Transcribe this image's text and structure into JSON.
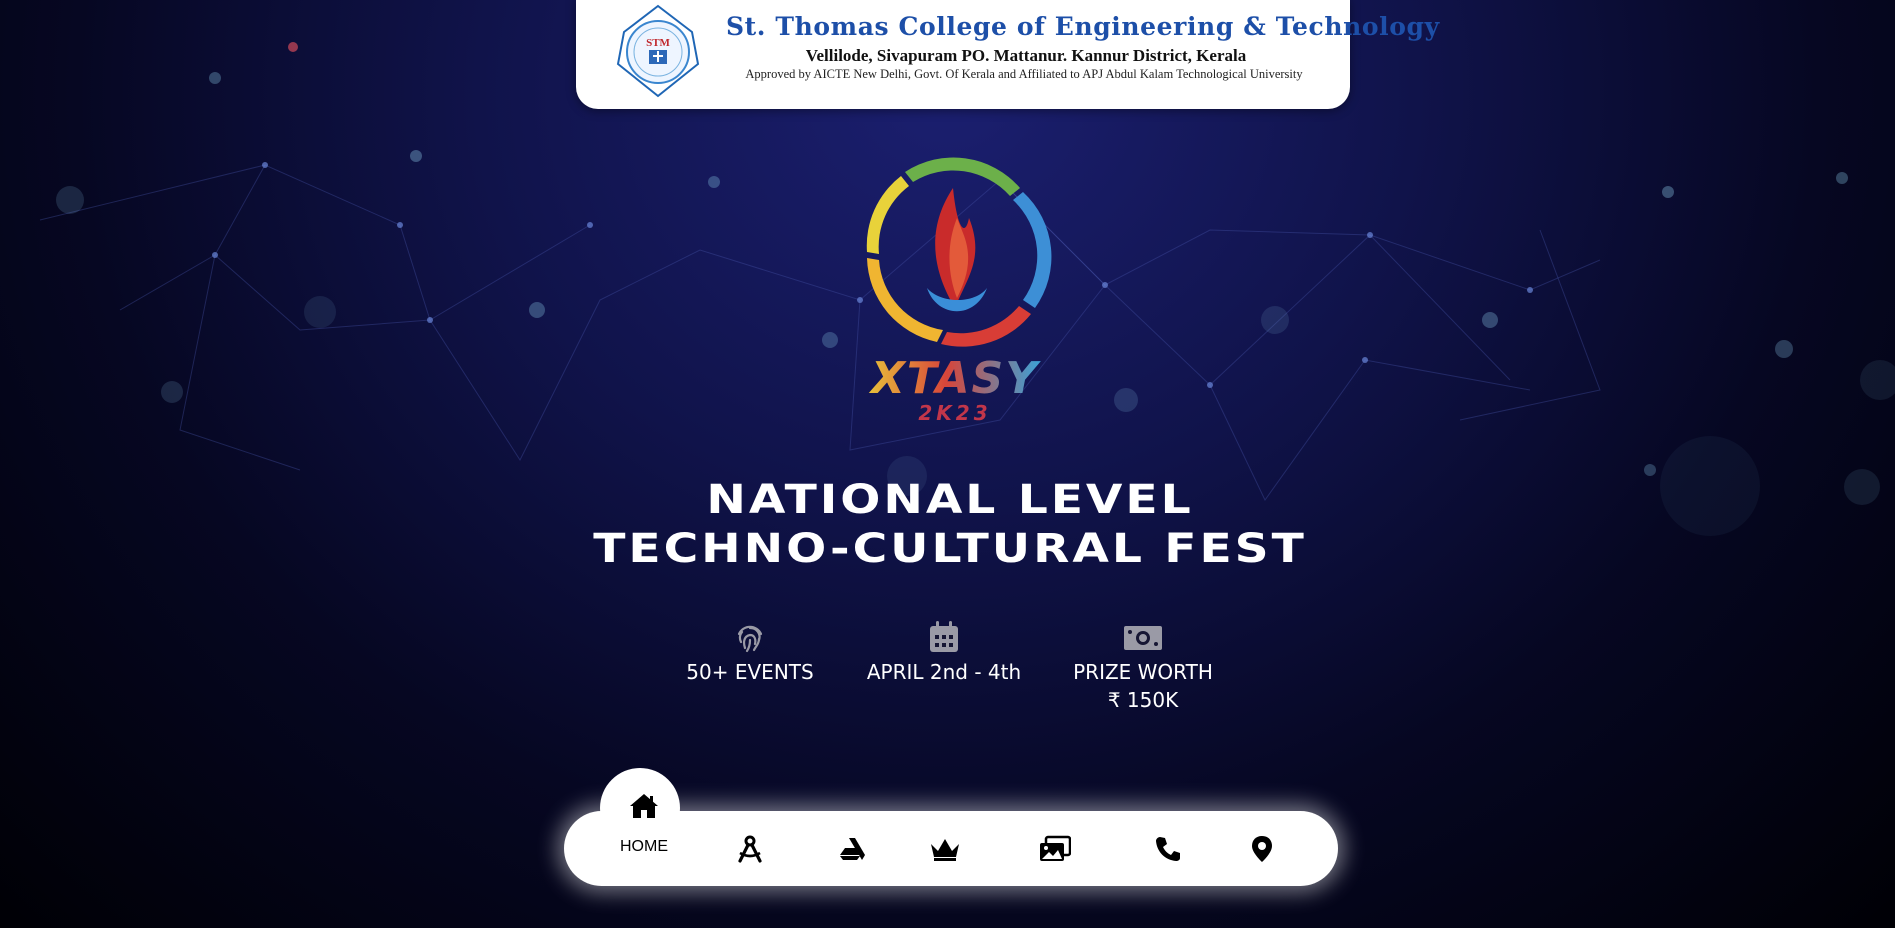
{
  "college": {
    "name": "St. Thomas College of Engineering & Technology",
    "address": "Vellilode, Sivapuram PO. Mattanur. Kannur District, Kerala",
    "approval": "Approved by AICTE New Delhi, Govt. Of Kerala and Affiliated to APJ Abdul Kalam Technological University",
    "seal_text": "STM"
  },
  "fest": {
    "logo_text": "XTASY",
    "logo_year": "2K23"
  },
  "headline": {
    "line1": "NATIONAL LEVEL",
    "line2": "TECHNO-CULTURAL FEST"
  },
  "stats": [
    {
      "icon": "fingerprint-icon",
      "text": "50+ EVENTS"
    },
    {
      "icon": "calendar-icon",
      "text": "APRIL 2nd - 4th"
    },
    {
      "icon": "money-icon",
      "line1": "PRIZE WORTH",
      "line2": "₹ 150K"
    }
  ],
  "nav": {
    "active": "home",
    "items": [
      {
        "id": "home",
        "icon": "home-icon",
        "label": "HOME"
      },
      {
        "id": "events",
        "icon": "compass-drafting-icon"
      },
      {
        "id": "about",
        "icon": "artstation-icon"
      },
      {
        "id": "proshows",
        "icon": "crown-icon"
      },
      {
        "id": "gallery",
        "icon": "images-icon"
      },
      {
        "id": "contact",
        "icon": "phone-icon"
      },
      {
        "id": "location",
        "icon": "location-pin-icon"
      }
    ]
  },
  "colors": {
    "background_top": "#1b1f70",
    "background_bottom": "#000005",
    "college_name": "#1d4fa8",
    "nav_bg": "#ffffff",
    "icon_gray": "#9a9aa6"
  }
}
